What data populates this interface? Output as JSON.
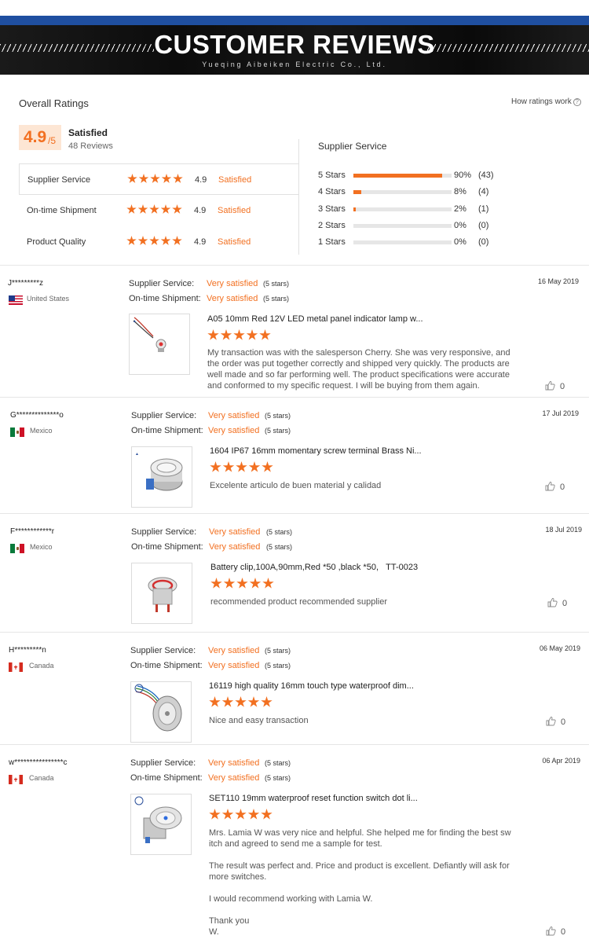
{
  "banner": {
    "title": "CUSTOMER REVIEWS",
    "subtitle": "Yueqing Aibeiken Electric Co., Ltd."
  },
  "overall": {
    "title": "Overall Ratings",
    "how_link": "How ratings work",
    "score": "4.9",
    "score_den": "/5",
    "satisfaction": "Satisfied",
    "reviews_count": "48 Reviews",
    "categories": [
      {
        "label": "Supplier Service",
        "stars": 5,
        "score": "4.9",
        "status": "Satisfied"
      },
      {
        "label": "On-time Shipment",
        "stars": 5,
        "score": "4.9",
        "status": "Satisfied"
      },
      {
        "label": "Product Quality",
        "stars": 5,
        "score": "4.9",
        "status": "Satisfied"
      }
    ]
  },
  "supplier_service": {
    "title": "Supplier Service",
    "bars": [
      {
        "label": "5 Stars",
        "fraction": 0.9,
        "pct": "90%",
        "count": "(43)"
      },
      {
        "label": "4 Stars",
        "fraction": 0.08,
        "pct": "8%",
        "count": "(4)"
      },
      {
        "label": "3 Stars",
        "fraction": 0.02,
        "pct": "2%",
        "count": "(1)"
      },
      {
        "label": "2 Stars",
        "fraction": 0.0,
        "pct": "0%",
        "count": "(0)"
      },
      {
        "label": "1 Stars",
        "fraction": 0.0,
        "pct": "0%",
        "count": "(0)"
      }
    ]
  },
  "labels": {
    "supplier_service": "Supplier Service:",
    "ontime_shipment": "On-time Shipment:",
    "very_satisfied": "Very satisfied",
    "five_stars": "(5 stars)"
  },
  "colors": {
    "accent": "#f27021",
    "banner_blue": "#1f4fa0"
  },
  "reviews": [
    {
      "user": "J*********z",
      "country": "United States",
      "flag": "us",
      "date": "16 May 2019",
      "product": "A05 10mm Red 12V LED metal panel indicator lamp w...",
      "stars": 5,
      "text": [
        "My transaction was with the salesperson Cherry. She was very responsive, and the order was put together correctly and shipped very quickly. The products are well made and so far performing well. The product specifications were accurate and conformed to my specific request. I will be buying from them again."
      ],
      "likes": "0",
      "thumb": "wire-lamp"
    },
    {
      "user": "G**************o",
      "country": "Mexico",
      "flag": "mx",
      "date": "17 Jul 2019",
      "product": "1604 IP67 16mm momentary screw terminal Brass Ni...",
      "stars": 5,
      "text": [
        "Excelente articulo de buen material y calidad"
      ],
      "likes": "0",
      "thumb": "metal-button"
    },
    {
      "user": "F************r",
      "country": "Mexico",
      "flag": "mx",
      "date": "18 Jul 2019",
      "product": "Battery clip,100A,90mm,Red *50 ,black *50,   TT-0023",
      "stars": 5,
      "text": [
        "recommended product recommended supplier"
      ],
      "likes": "0",
      "thumb": "ring-button"
    },
    {
      "user": "H*********n",
      "country": "Canada",
      "flag": "ca",
      "date": "06 May 2019",
      "product": "16119 high quality 16mm touch type waterproof dim...",
      "stars": 5,
      "text": [
        "Nice and easy transaction"
      ],
      "likes": "0",
      "thumb": "touch-switch"
    },
    {
      "user": "w****************c",
      "country": "Canada",
      "flag": "ca",
      "date": "06 Apr 2019",
      "product": "SET110 19mm waterproof reset function switch dot li...",
      "stars": 5,
      "text": [
        "Mrs. Lamia W was very nice and helpful. She helped me for finding the best switch and agreed to send me a sample for test.",
        "The result was perfect and. Price and product is excellent. Defiantly will ask for more switches.",
        "I would recommend working with Lamia W.",
        "Thank you\nW."
      ],
      "likes": "0",
      "thumb": "reset-switch"
    }
  ]
}
